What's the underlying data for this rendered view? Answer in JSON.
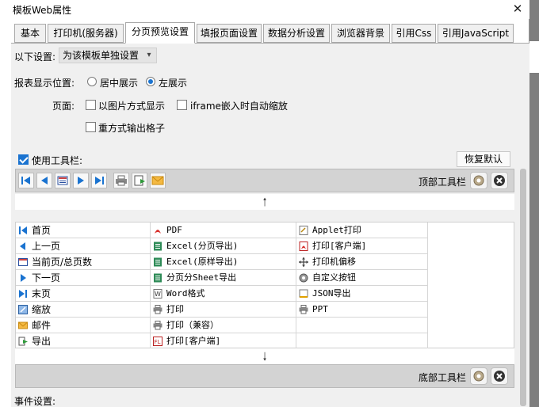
{
  "window": {
    "title": "模板Web属性",
    "close_glyph": "✕"
  },
  "tabs": [
    {
      "label": "基本"
    },
    {
      "label": "打印机(服务器)"
    },
    {
      "label": "分页预览设置"
    },
    {
      "label": "填报页面设置"
    },
    {
      "label": "数据分析设置"
    },
    {
      "label": "浏览器背景"
    },
    {
      "label": "引用Css"
    },
    {
      "label": "引用JavaScript"
    }
  ],
  "settings": {
    "label": "以下设置:",
    "value": "为该模板单独设置"
  },
  "position": {
    "label": "报表显示位置:",
    "center": "居中展示",
    "left": "左展示"
  },
  "page": {
    "label": "页面:",
    "image_mode": "以图片方式显示",
    "iframe_zoom": "iframe嵌入时自动缩放",
    "repeat_grid": "重方式输出格子"
  },
  "toolbar": {
    "use_label": "使用工具栏:",
    "restore_label": "恢复默认",
    "top_label": "顶部工具栏",
    "bottom_label": "底部工具栏"
  },
  "events": {
    "label": "事件设置:"
  },
  "buttons": {
    "col1": [
      "首页",
      "上一页",
      "当前页/总页数",
      "下一页",
      "末页",
      "缩放",
      "邮件",
      "导出"
    ],
    "col2": [
      "PDF",
      "Excel(分页导出)",
      "Excel(原样导出)",
      "分页分Sheet导出",
      "Word格式",
      "打印",
      "打印（兼容）",
      "打印[客户端]"
    ],
    "col3": [
      "Applet打印",
      "打印[客户端]",
      "打印机偏移",
      "自定义按钮",
      "JSON导出",
      "PPT",
      "",
      ""
    ]
  },
  "colors": {
    "accent": "#1a73d0",
    "toolbar_bg": "#d3d3d3",
    "panel_bg": "#f0f0f0"
  }
}
